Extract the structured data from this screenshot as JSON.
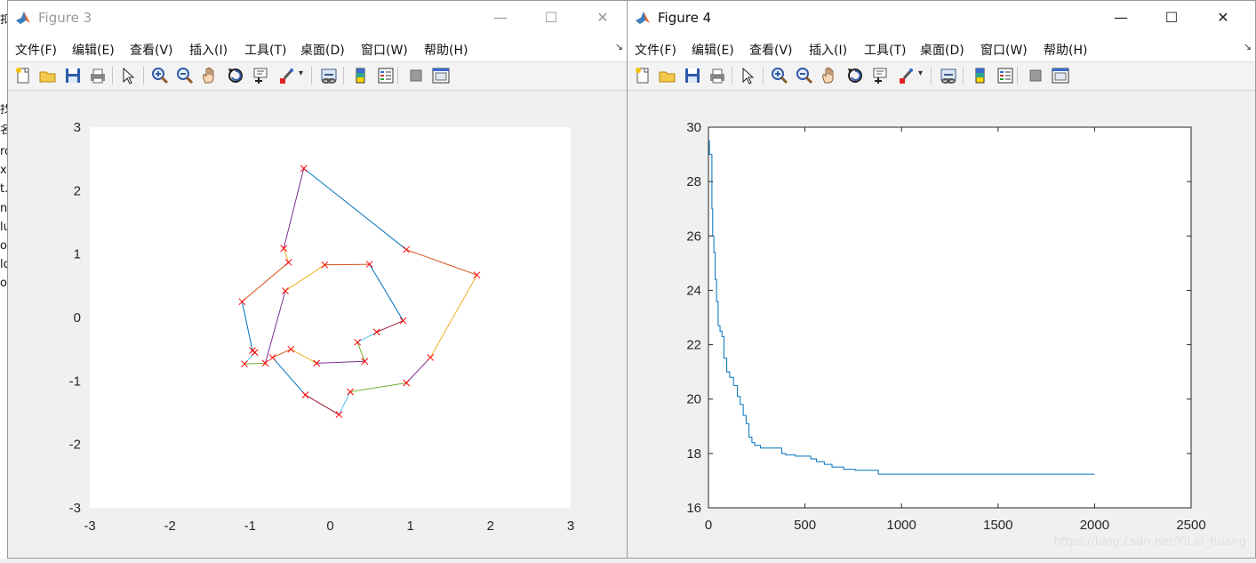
{
  "background_window": {
    "fragments": [
      "扣",
      "找",
      "名",
      "ro",
      "xе",
      "t.",
      "na",
      "lu",
      "oy",
      "ld",
      "o"
    ]
  },
  "figure3": {
    "title": "Figure 3",
    "window_controls": {
      "minimize": "—",
      "maximize": "☐",
      "close": "✕"
    },
    "menu": [
      "文件(F)",
      "编辑(E)",
      "查看(V)",
      "插入(I)",
      "工具(T)",
      "桌面(D)",
      "窗口(W)",
      "帮助(H)"
    ],
    "menu_overflow": "↘",
    "toolbar_icons": [
      "new-figure-icon",
      "open-file-icon",
      "save-icon",
      "print-icon",
      "select-arrow-icon",
      "zoom-in-icon",
      "zoom-out-icon",
      "pan-hand-icon",
      "rotate-3d-icon",
      "data-cursor-icon",
      "brush-icon",
      "link-icon",
      "colorbar-icon",
      "legend-icon",
      "hide-plot-tools-icon",
      "show-plot-tools-icon"
    ]
  },
  "figure4": {
    "title": "Figure 4",
    "window_controls": {
      "minimize": "—",
      "maximize": "☐",
      "close": "✕"
    },
    "menu": [
      "文件(F)",
      "编辑(E)",
      "查看(V)",
      "插入(I)",
      "工具(T)",
      "桌面(D)",
      "窗口(W)",
      "帮助(H)"
    ],
    "menu_overflow": "↘",
    "watermark": "https://blog.csdn.net/YiLin_huang"
  },
  "chart_data": [
    {
      "type": "line",
      "figure": "Figure 3",
      "xlim": [
        -3,
        3
      ],
      "ylim": [
        -3,
        3
      ],
      "xticks": [
        -3,
        -2,
        -1,
        0,
        1,
        2,
        3
      ],
      "yticks": [
        -3,
        -2,
        -1,
        0,
        1,
        2,
        3
      ],
      "grid": false,
      "marker": "x",
      "marker_color": "#ff0000",
      "series_colors": [
        "#0072bd",
        "#d95319",
        "#edb120",
        "#7e2f8e",
        "#77ac30",
        "#4dbeee",
        "#a2142f"
      ],
      "tour": [
        [
          -0.33,
          2.35
        ],
        [
          0.95,
          1.07
        ],
        [
          1.83,
          0.67
        ],
        [
          1.25,
          -0.63
        ],
        [
          0.95,
          -1.03
        ],
        [
          0.25,
          -1.17
        ],
        [
          0.11,
          -1.53
        ],
        [
          -0.31,
          -1.22
        ],
        [
          -0.72,
          -0.63
        ],
        [
          -0.49,
          -0.5
        ],
        [
          -0.17,
          -0.72
        ],
        [
          0.43,
          -0.69
        ],
        [
          0.34,
          -0.39
        ],
        [
          0.58,
          -0.23
        ],
        [
          0.91,
          -0.05
        ],
        [
          0.49,
          0.84
        ],
        [
          -0.07,
          0.83
        ],
        [
          -0.56,
          0.42
        ],
        [
          -0.81,
          -0.72
        ],
        [
          -1.07,
          -0.73
        ],
        [
          -0.94,
          -0.55
        ],
        [
          -0.97,
          -0.52
        ],
        [
          -1.1,
          0.25
        ],
        [
          -0.52,
          0.87
        ],
        [
          -0.58,
          1.09
        ],
        [
          -0.33,
          2.35
        ]
      ]
    },
    {
      "type": "line",
      "figure": "Figure 4",
      "xlim": [
        0,
        2500
      ],
      "ylim": [
        16,
        30
      ],
      "xticks": [
        0,
        500,
        1000,
        1500,
        2000,
        2500
      ],
      "yticks": [
        16,
        18,
        20,
        22,
        24,
        26,
        28,
        30
      ],
      "grid": false,
      "series_color": "#0072bd",
      "x": [
        0,
        5,
        5,
        18,
        18,
        22,
        22,
        28,
        28,
        35,
        35,
        42,
        42,
        50,
        50,
        60,
        60,
        70,
        70,
        80,
        80,
        95,
        95,
        110,
        110,
        130,
        130,
        150,
        150,
        165,
        165,
        180,
        180,
        195,
        195,
        210,
        210,
        225,
        225,
        240,
        240,
        270,
        270,
        300,
        300,
        330,
        330,
        380,
        380,
        400,
        400,
        450,
        450,
        530,
        530,
        560,
        560,
        600,
        600,
        640,
        640,
        700,
        700,
        760,
        760,
        880,
        880,
        2000
      ],
      "y": [
        29.5,
        29.5,
        29.0,
        29.0,
        27.0,
        27.0,
        26.0,
        26.0,
        25.4,
        25.4,
        24.4,
        24.4,
        23.6,
        23.6,
        22.7,
        22.7,
        22.5,
        22.5,
        22.3,
        22.3,
        21.5,
        21.5,
        21.0,
        21.0,
        20.8,
        20.8,
        20.5,
        20.5,
        20.1,
        20.1,
        19.8,
        19.8,
        19.4,
        19.4,
        19.1,
        19.1,
        18.6,
        18.6,
        18.4,
        18.4,
        18.3,
        18.3,
        18.2,
        18.2,
        18.2,
        18.2,
        18.2,
        18.2,
        18.0,
        18.0,
        17.95,
        17.95,
        17.9,
        17.9,
        17.8,
        17.8,
        17.7,
        17.7,
        17.6,
        17.6,
        17.5,
        17.5,
        17.42,
        17.42,
        17.38,
        17.38,
        17.24,
        17.24
      ]
    }
  ]
}
